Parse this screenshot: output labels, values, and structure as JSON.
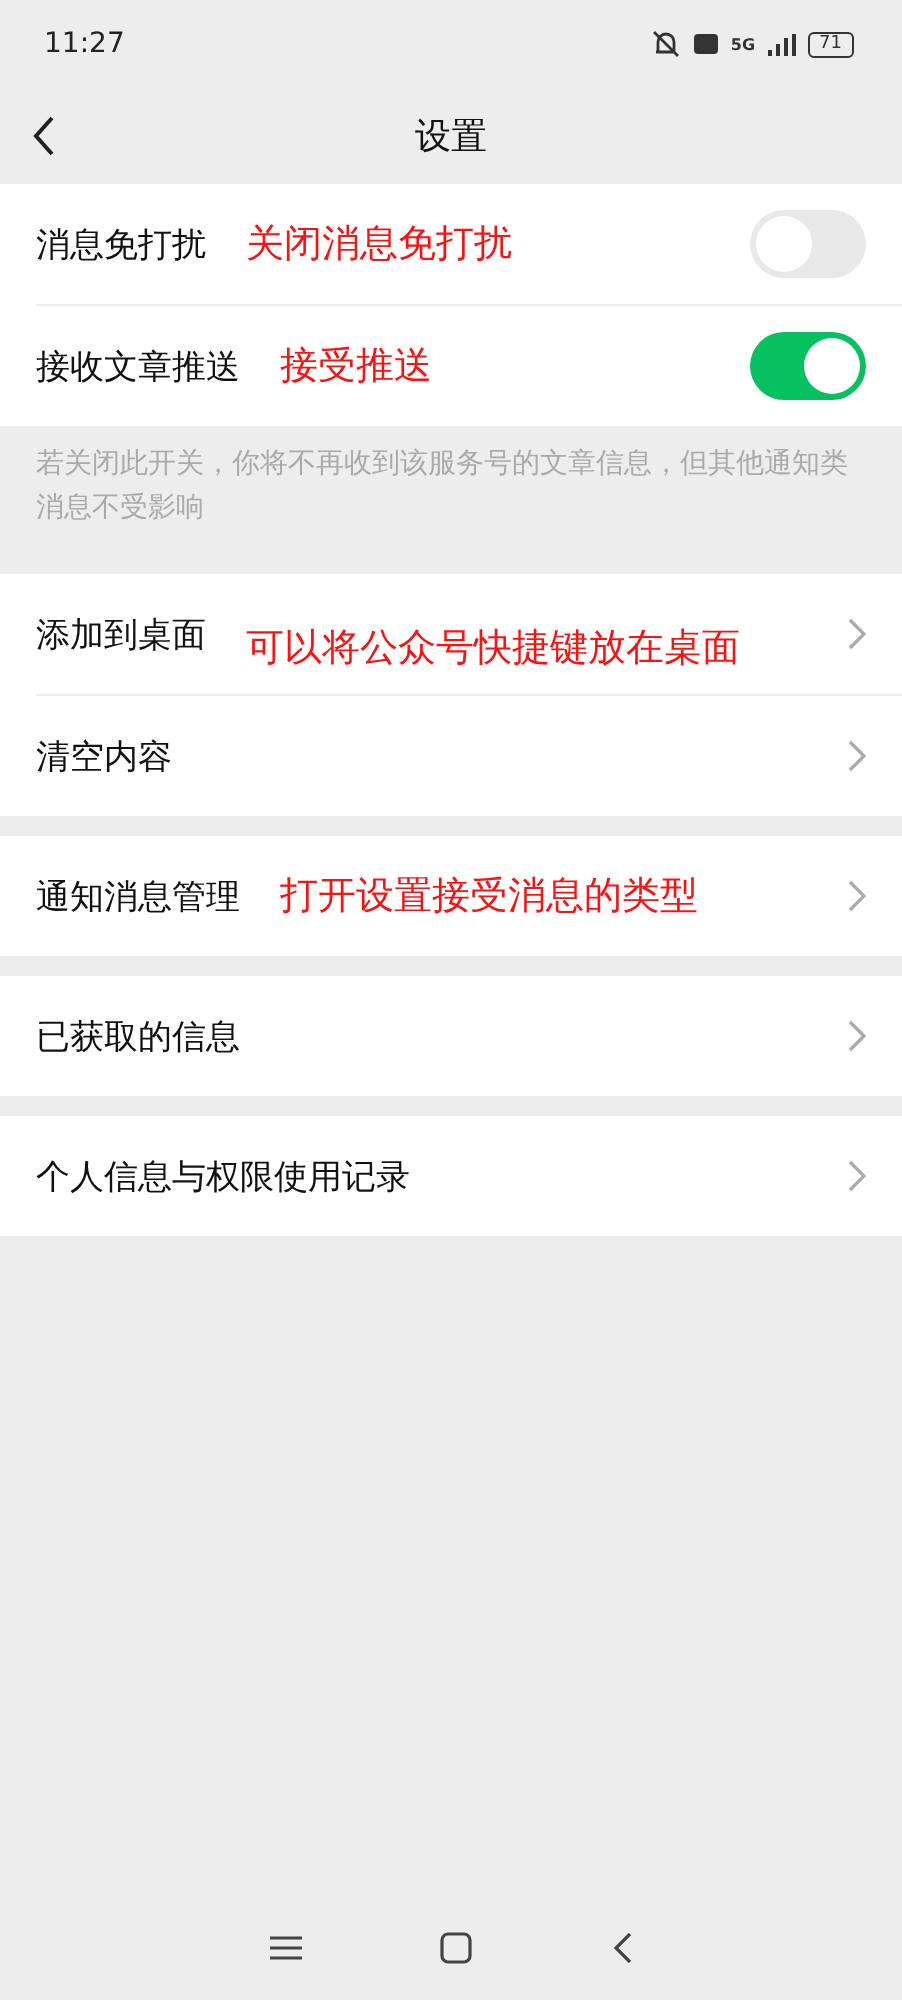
{
  "status_bar": {
    "time": "11:27",
    "battery": "71",
    "network": "5G"
  },
  "nav": {
    "title": "设置"
  },
  "sections": [
    {
      "rows": [
        {
          "kind": "toggle",
          "label": "消息免打扰",
          "on": false,
          "annotation": "关闭消息免打扰"
        },
        {
          "kind": "toggle",
          "label": "接收文章推送",
          "on": true,
          "annotation": "接受推送"
        }
      ],
      "note": "若关闭此开关，你将不再收到该服务号的文章信息，但其他通知类消息不受影响"
    },
    {
      "rows": [
        {
          "kind": "link",
          "label": "添加到桌面",
          "annotation": "可以将公众号快捷键放在桌面"
        },
        {
          "kind": "link",
          "label": "清空内容"
        }
      ]
    },
    {
      "rows": [
        {
          "kind": "link",
          "label": "通知消息管理",
          "annotation": "打开设置接受消息的类型"
        }
      ]
    },
    {
      "rows": [
        {
          "kind": "link",
          "label": "已获取的信息"
        }
      ]
    },
    {
      "rows": [
        {
          "kind": "link",
          "label": "个人信息与权限使用记录"
        }
      ]
    }
  ]
}
